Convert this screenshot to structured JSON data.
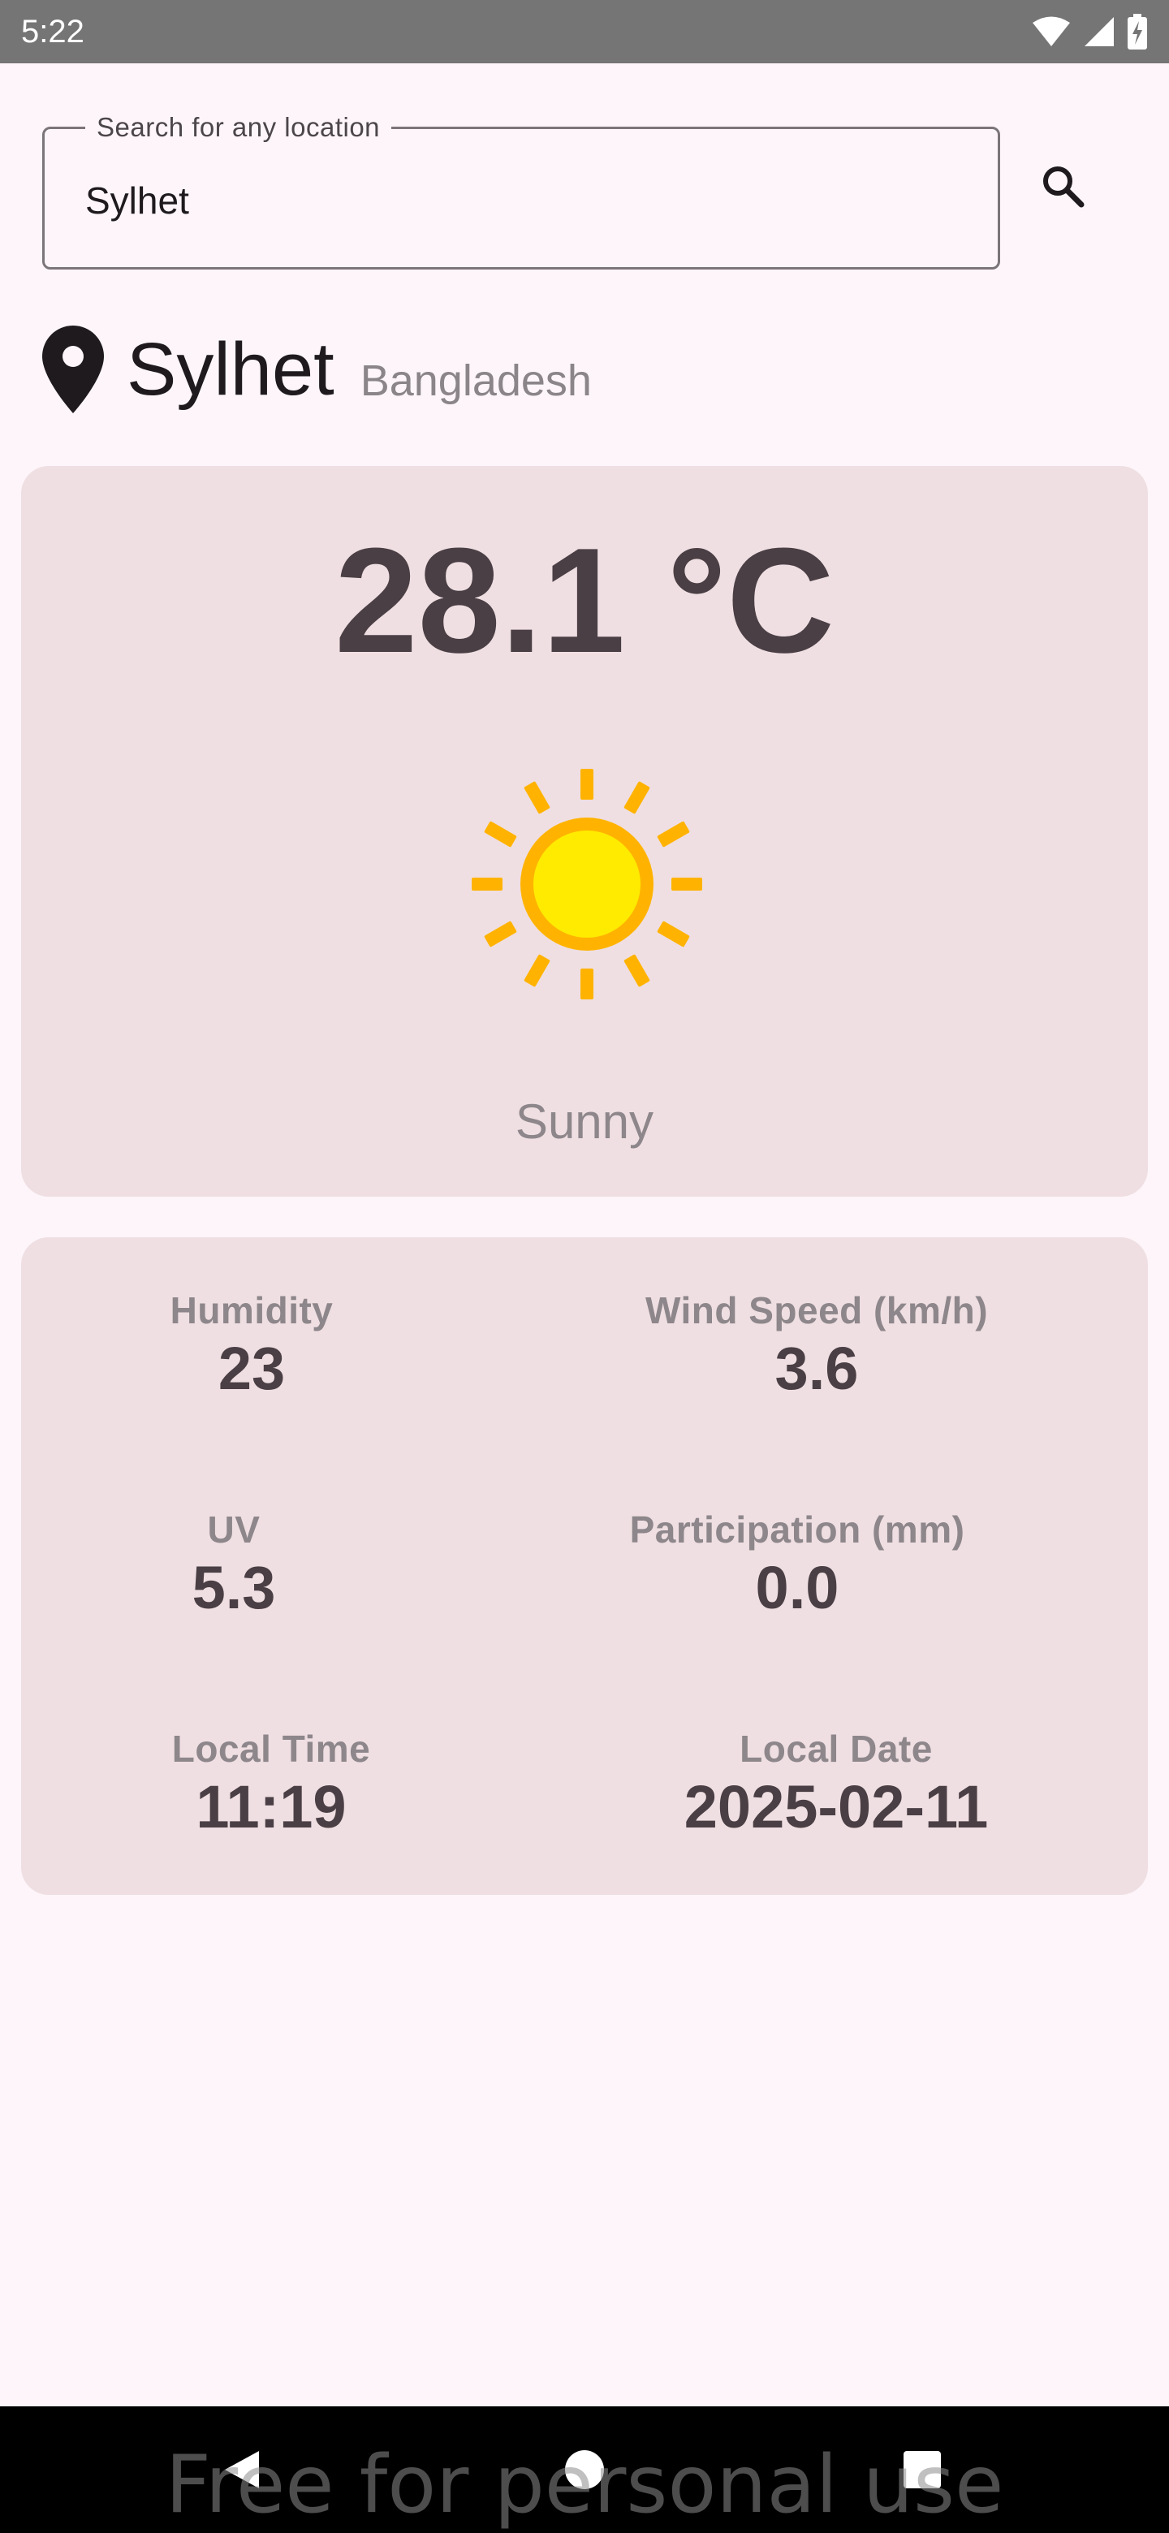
{
  "status_bar": {
    "time": "5:22",
    "icons": [
      "wifi-icon",
      "signal-icon",
      "battery-charging-icon"
    ]
  },
  "search": {
    "label": "Search for any location",
    "value": "Sylhet",
    "button_icon": "search-icon"
  },
  "location": {
    "icon": "location-pin-icon",
    "city": "Sylhet",
    "country": "Bangladesh"
  },
  "weather": {
    "temperature": "28.1 °C",
    "condition": "Sunny",
    "icon": "sun-icon"
  },
  "details": [
    {
      "label": "Humidity",
      "value": "23"
    },
    {
      "label": "Wind Speed (km/h)",
      "value": "3.6"
    },
    {
      "label": "UV",
      "value": "5.3"
    },
    {
      "label": "Participation (mm)",
      "value": "0.0"
    },
    {
      "label": "Local Time",
      "value": "11:19"
    },
    {
      "label": "Local Date",
      "value": "2025-02-11"
    }
  ],
  "nav_bar": {
    "buttons": [
      "back-icon",
      "home-icon",
      "recents-icon"
    ]
  },
  "watermark": "Free for personal use",
  "colors": {
    "background": "#fdf5f9",
    "card": "#efdfe2",
    "primary_text": "#4a3f44",
    "secondary_text": "#8d868a",
    "sun_core": "#ffeb00",
    "sun_rays": "#ffb300"
  }
}
